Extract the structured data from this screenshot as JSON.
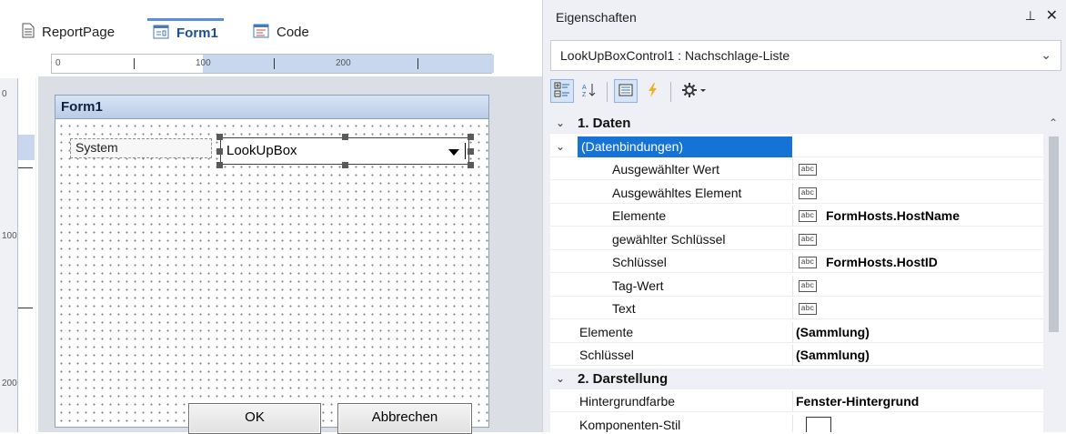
{
  "designer": {
    "tabs": [
      {
        "label": "ReportPage",
        "icon": "page-icon"
      },
      {
        "label": "Form1",
        "icon": "form-icon",
        "active": true
      },
      {
        "label": "Code",
        "icon": "code-icon"
      }
    ],
    "ruler_h": [
      "0",
      "100",
      "200"
    ],
    "ruler_v": [
      "0",
      "100",
      "200"
    ],
    "form": {
      "caption": "Form1",
      "label_system": "System",
      "lookup_text": "LookUpBox",
      "ok": "OK",
      "cancel": "Abbrechen"
    }
  },
  "properties": {
    "title": "Eigenschaften",
    "pin_glyph": "⊥",
    "close_glyph": "✕",
    "object": "LookUpBoxControl1 : Nachschlage-Liste",
    "rows": [
      {
        "label": "1. Daten",
        "type": "category",
        "expander": "⌄"
      },
      {
        "label": "(Datenbindungen)",
        "type": "selected",
        "expander": "⌄"
      },
      {
        "label": "Ausgewählter Wert",
        "type": "binding",
        "value": ""
      },
      {
        "label": "Ausgewähltes Element",
        "type": "binding",
        "value": ""
      },
      {
        "label": "Elemente",
        "type": "binding",
        "value": "FormHosts.HostName"
      },
      {
        "label": "gewählter Schlüssel",
        "type": "binding",
        "value": ""
      },
      {
        "label": "Schlüssel",
        "type": "binding",
        "value": "FormHosts.HostID"
      },
      {
        "label": "Tag-Wert",
        "type": "binding",
        "value": ""
      },
      {
        "label": "Text",
        "type": "binding",
        "value": ""
      },
      {
        "label": "Elemente",
        "type": "prop",
        "value": "(Sammlung)"
      },
      {
        "label": "Schlüssel",
        "type": "prop",
        "value": "(Sammlung)"
      },
      {
        "label": "2. Darstellung",
        "type": "category",
        "expander": "⌄"
      },
      {
        "label": "Hintergrundfarbe",
        "type": "prop",
        "value": "Fenster-Hintergrund"
      },
      {
        "label": "Komponenten-Stil",
        "type": "color",
        "value": ""
      }
    ],
    "abc_glyph": "abc",
    "colors": {
      "selection": "#1473d5",
      "panel": "#eef0f5"
    }
  }
}
